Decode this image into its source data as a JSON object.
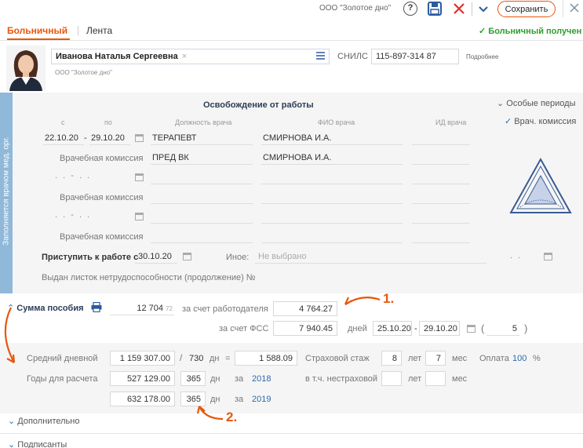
{
  "colors": {
    "brand": "#e8570c",
    "accent": "#2b6cb0",
    "green": "#2e9e2e",
    "sidebar": "#8fb8d9"
  },
  "toolbar": {
    "org": "ООО \"Золотое дно\"",
    "save_label": "Сохранить"
  },
  "tabs": [
    {
      "label": "Больничный"
    },
    {
      "label": "Лента"
    }
  ],
  "status": {
    "text": "Больничный получен",
    "icon": "check-icon"
  },
  "person": {
    "name": "Иванова Наталья Сергеевна",
    "org": "ООО \"Золотое дно\"",
    "snils_label": "СНИЛС",
    "snils": "115-897-314 87",
    "more": "Подробнее"
  },
  "sidebar": {
    "text": "Заполняется врачом мед. орг."
  },
  "release": {
    "title": "Освобождение от работы",
    "special": "Особые периоды",
    "commission_check": "Врач. комиссия",
    "headers": {
      "from": "с",
      "to": "по",
      "position": "Должность врача",
      "fio": "ФИО врача",
      "id": "ИД врача"
    },
    "row1": {
      "from": "22.10.20",
      "to": "29.10.20",
      "position": "ТЕРАПЕВТ",
      "doctor": "СМИРНОВА И.А."
    },
    "commission_label": "Врачебная комиссия",
    "row1_commission": {
      "position": "ПРЕД ВК",
      "doctor": "СМИРНОВА И.А."
    },
    "return_label": "Приступить к работе с",
    "return_date": "30.10.20",
    "other_label": "Иное:",
    "other_value": "Не выбрано",
    "continuation": "Выдан листок нетрудоспособности (продолжение) №"
  },
  "benefit": {
    "title": "Сумма пособия",
    "total_int": "12 704",
    "total_frac": "72",
    "employer_label": "за счет работодателя",
    "employer": "4 764.27",
    "fss_label": "за счет ФСС",
    "fss": "7 940.45",
    "days_label": "дней",
    "fss_from": "25.10.20",
    "fss_to": "29.10.20",
    "days": "5"
  },
  "calc": {
    "avg_label": "Средний дневной",
    "avg_sum": "1 159 307.00",
    "avg_div": "730",
    "unit_days": "дн",
    "avg_result": "1 588.09",
    "experience_label": "Страховой стаж",
    "exp_years": "8",
    "years_unit": "лет",
    "exp_months": "7",
    "months_unit": "мес",
    "payment_label": "Оплата",
    "payment_value": "100",
    "payment_unit": "%",
    "years_label": "Годы для расчета",
    "year1_sum": "527 129.00",
    "year1_days": "365",
    "for_label": "за",
    "year1": "2018",
    "year2_sum": "632 178.00",
    "year2_days": "365",
    "year2": "2019",
    "noninsurance_label": "в т.ч. нестраховой"
  },
  "sections": {
    "additional": "Дополнительно",
    "signers": "Подписанты"
  },
  "annotations": {
    "one": "1.",
    "two": "2."
  }
}
